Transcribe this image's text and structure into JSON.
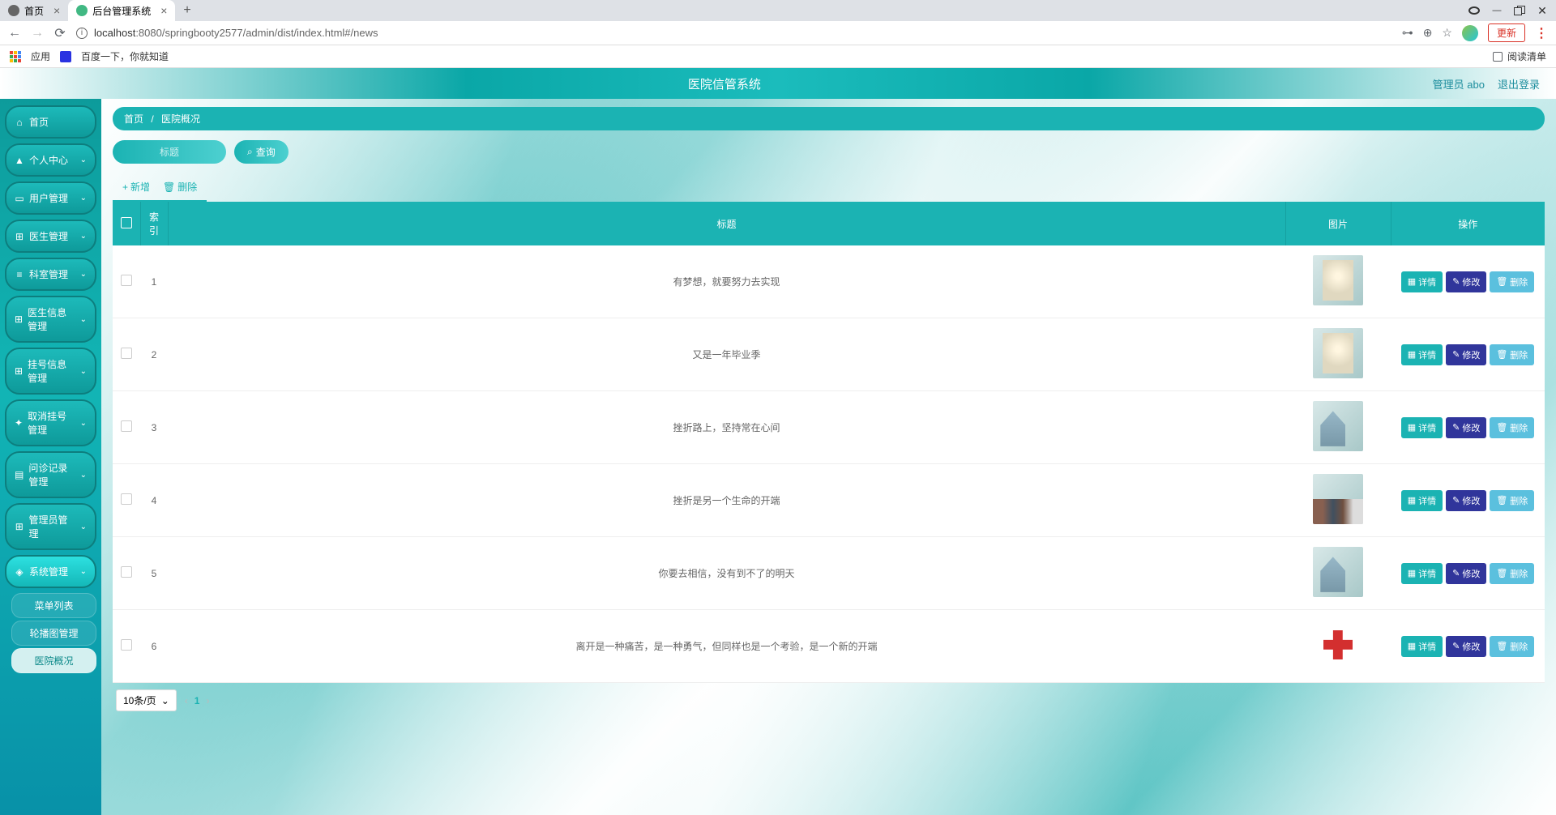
{
  "browser": {
    "tabs": [
      {
        "title": "首页",
        "active": false
      },
      {
        "title": "后台管理系统",
        "active": true
      }
    ],
    "url_host": "localhost",
    "url_path": ":8080/springbooty2577/admin/dist/index.html#/news",
    "update_label": "更新",
    "bookmarks": {
      "apps": "应用",
      "baidu": "百度一下，你就知道",
      "reading_list": "阅读清单"
    }
  },
  "header": {
    "title": "医院信管系统",
    "admin_label": "管理员 abo",
    "logout_label": "退出登录"
  },
  "sidebar": {
    "items": [
      {
        "icon": "●",
        "label": "首页"
      },
      {
        "icon": "👤",
        "label": "个人中心"
      },
      {
        "icon": "▭",
        "label": "用户管理"
      },
      {
        "icon": "⊞",
        "label": "医生管理"
      },
      {
        "icon": "≡",
        "label": "科室管理"
      },
      {
        "icon": "⊞",
        "label": "医生信息管理"
      },
      {
        "icon": "⊞",
        "label": "挂号信息管理"
      },
      {
        "icon": "✦",
        "label": "取消挂号管理"
      },
      {
        "icon": "▤",
        "label": "问诊记录管理"
      },
      {
        "icon": "⊞",
        "label": "管理员管理"
      },
      {
        "icon": "◈",
        "label": "系统管理"
      }
    ],
    "system_children": [
      {
        "label": "菜单列表"
      },
      {
        "label": "轮播图管理"
      },
      {
        "label": "医院概况"
      }
    ]
  },
  "breadcrumb": {
    "home": "首页",
    "current": "医院概况"
  },
  "search": {
    "placeholder": "标题",
    "button": "查询"
  },
  "actions": {
    "add": "新增",
    "delete": "删除"
  },
  "table": {
    "headers": {
      "index": "索引",
      "title": "标题",
      "image": "图片",
      "ops": "操作"
    },
    "rows": [
      {
        "idx": "1",
        "title": "有梦想，就要努力去实现",
        "thumb": "hall"
      },
      {
        "idx": "2",
        "title": "又是一年毕业季",
        "thumb": "hall"
      },
      {
        "idx": "3",
        "title": "挫折路上，坚持常在心间",
        "thumb": "building"
      },
      {
        "idx": "4",
        "title": "挫折是另一个生命的开端",
        "thumb": "people"
      },
      {
        "idx": "5",
        "title": "你要去相信，没有到不了的明天",
        "thumb": "building"
      },
      {
        "idx": "6",
        "title": "离开是一种痛苦，是一种勇气，但同样也是一个考验，是一个新的开端",
        "thumb": "cross"
      }
    ],
    "op_labels": {
      "detail": "详情",
      "edit": "修改",
      "delete": "删除"
    }
  },
  "pagination": {
    "page_size": "10条/页",
    "current": "1"
  }
}
